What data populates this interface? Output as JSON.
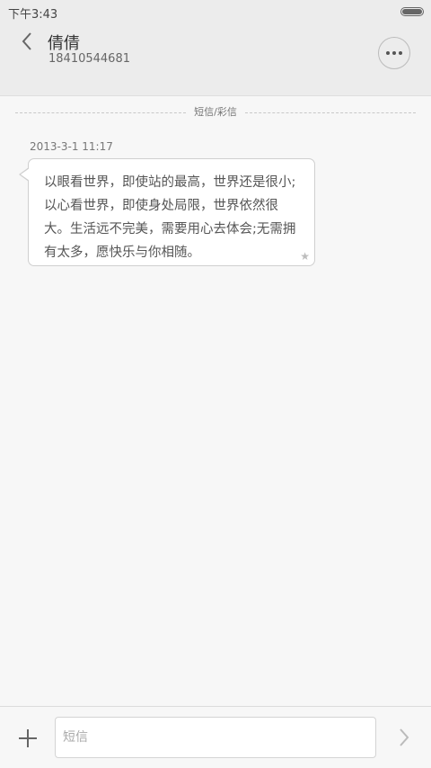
{
  "status_bar": {
    "time": "下午3:43"
  },
  "header": {
    "back_icon": "chevron-left-icon",
    "contact_name": "倩倩",
    "contact_number": "18410544681",
    "more_icon": "more-horizontal-icon"
  },
  "thread": {
    "section_label": "短信/彩信",
    "messages": [
      {
        "timestamp": "2013-3-1 11:17",
        "text": "以眼看世界，即使站的最高，世界还是很小;以心看世界，即使身处局限，世界依然很大。生活远不完美，需要用心去体会;无需拥有太多，愿快乐与你相随。",
        "starred_icon": "star-icon"
      }
    ]
  },
  "composer": {
    "add_icon": "plus-icon",
    "placeholder": "短信",
    "value": "",
    "send_icon": "chevron-right-icon"
  }
}
